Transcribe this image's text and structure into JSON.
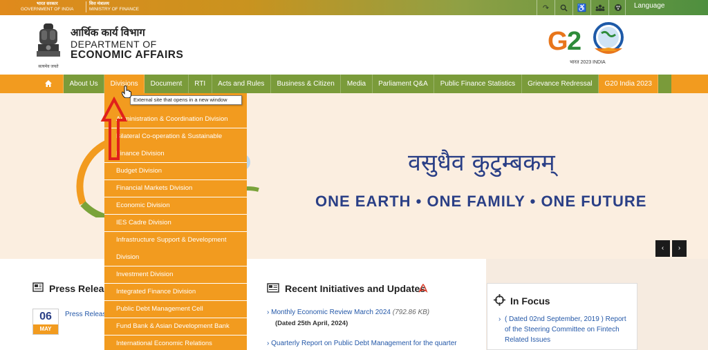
{
  "topbar": {
    "gov_hi": "भारत सरकार",
    "gov_en": "GOVERNMENT OF INDIA",
    "min_hi": "वित्त मंत्रालय",
    "min_en": "MINISTRY OF FINANCE",
    "language": "Language",
    "icons": [
      "skip-icon",
      "search-icon",
      "accessibility-icon",
      "sitemap-icon",
      "contrast-icon"
    ]
  },
  "header": {
    "emblem_caption": "सत्यमेव जयते",
    "dept_hi": "आर्थिक कार्य विभाग",
    "dept_line1": "DEPARTMENT OF",
    "dept_line2": "ECONOMIC AFFAIRS",
    "g20_sub": "भारत 2023 INDIA"
  },
  "nav": {
    "items": [
      "About Us",
      "Divisions",
      "Document",
      "RTI",
      "Acts and Rules",
      "Business & Citizen",
      "Media",
      "Parliament Q&A",
      "Public Finance Statistics",
      "Grievance Redressal",
      "G20 India 2023"
    ]
  },
  "tooltip": "External site that opens in a new window",
  "dropdown": {
    "items": [
      "Administration & Coordination Division",
      "Bilateral Co-operation & Sustainable",
      "Finance Division",
      "Budget Division",
      "Financial Markets Division",
      "Economic Division",
      "IES Cadre Division",
      "Infrastructure Support & Development",
      "Division",
      "Investment Division",
      "Integrated Finance Division",
      "Public Debt Management Cell",
      "Fund Bank & Asian Development Bank",
      "International Economic Relations"
    ]
  },
  "banner": {
    "hindi": "वसुधैव कुटुम्बकम्",
    "english": "ONE EARTH • ONE FAMILY • ONE FUTURE"
  },
  "press": {
    "title": "Press Release",
    "day": "06",
    "month": "MAY",
    "link": "Press Release"
  },
  "initiatives": {
    "title": "Recent Initiatives and Updates",
    "items": [
      {
        "text": "Monthly Economic Review March 2024",
        "size": "(792.86 KB)",
        "date": "(Dated 25th April, 2024)"
      },
      {
        "text": "Quarterly Report on Public Debt Management for the quarter"
      }
    ]
  },
  "focus": {
    "title": "In Focus",
    "text": "( Dated 02nd September, 2019 ) Report of the Steering Committee on Fintech Related Issues"
  },
  "colors": {
    "orange": "#f29b1f",
    "green": "#7a9b3a",
    "navy": "#2a3f86"
  }
}
